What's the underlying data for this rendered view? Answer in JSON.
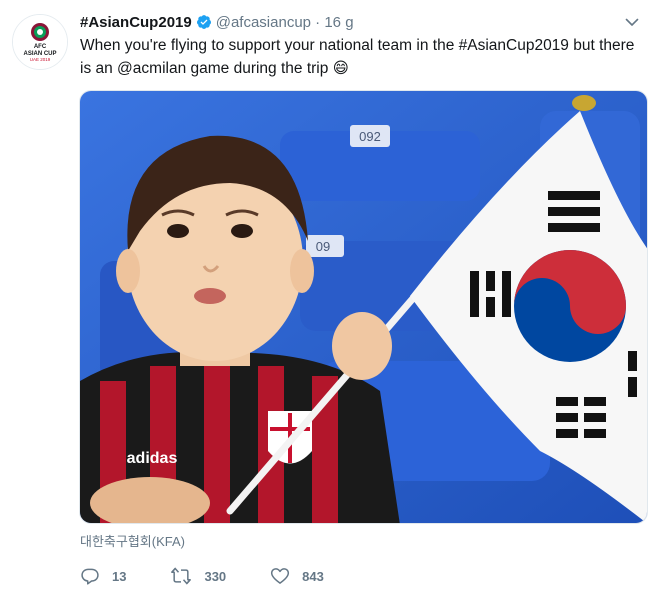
{
  "tweet": {
    "display_name": "#AsianCup2019",
    "handle": "@afcasiancup",
    "separator": "·",
    "time": "16 g",
    "text": "When you're flying to support your national team in the #AsianCup2019 but there is an @acmilan game during the trip 😄",
    "verified_icon": "verified-badge-icon",
    "caret_icon": "chevron-down-icon"
  },
  "avatar": {
    "logo_lines": [
      "AFC",
      "ASIAN CUP",
      "UAE 2019"
    ]
  },
  "media": {
    "seat_number_1": "092",
    "seat_number_2": "09",
    "kit_brand": "adidas",
    "description_colors": {
      "seat_blue": "#2c62d6",
      "stripe_red": "#b3162b",
      "flag_red": "#cd2e3a",
      "flag_blue": "#0047a0"
    }
  },
  "credit": "대한축구협회(KFA)",
  "actions": {
    "reply_count": "13",
    "retweet_count": "330",
    "like_count": "843"
  },
  "colors": {
    "link": "#1da1f2",
    "muted": "#657786",
    "text": "#14171a"
  }
}
